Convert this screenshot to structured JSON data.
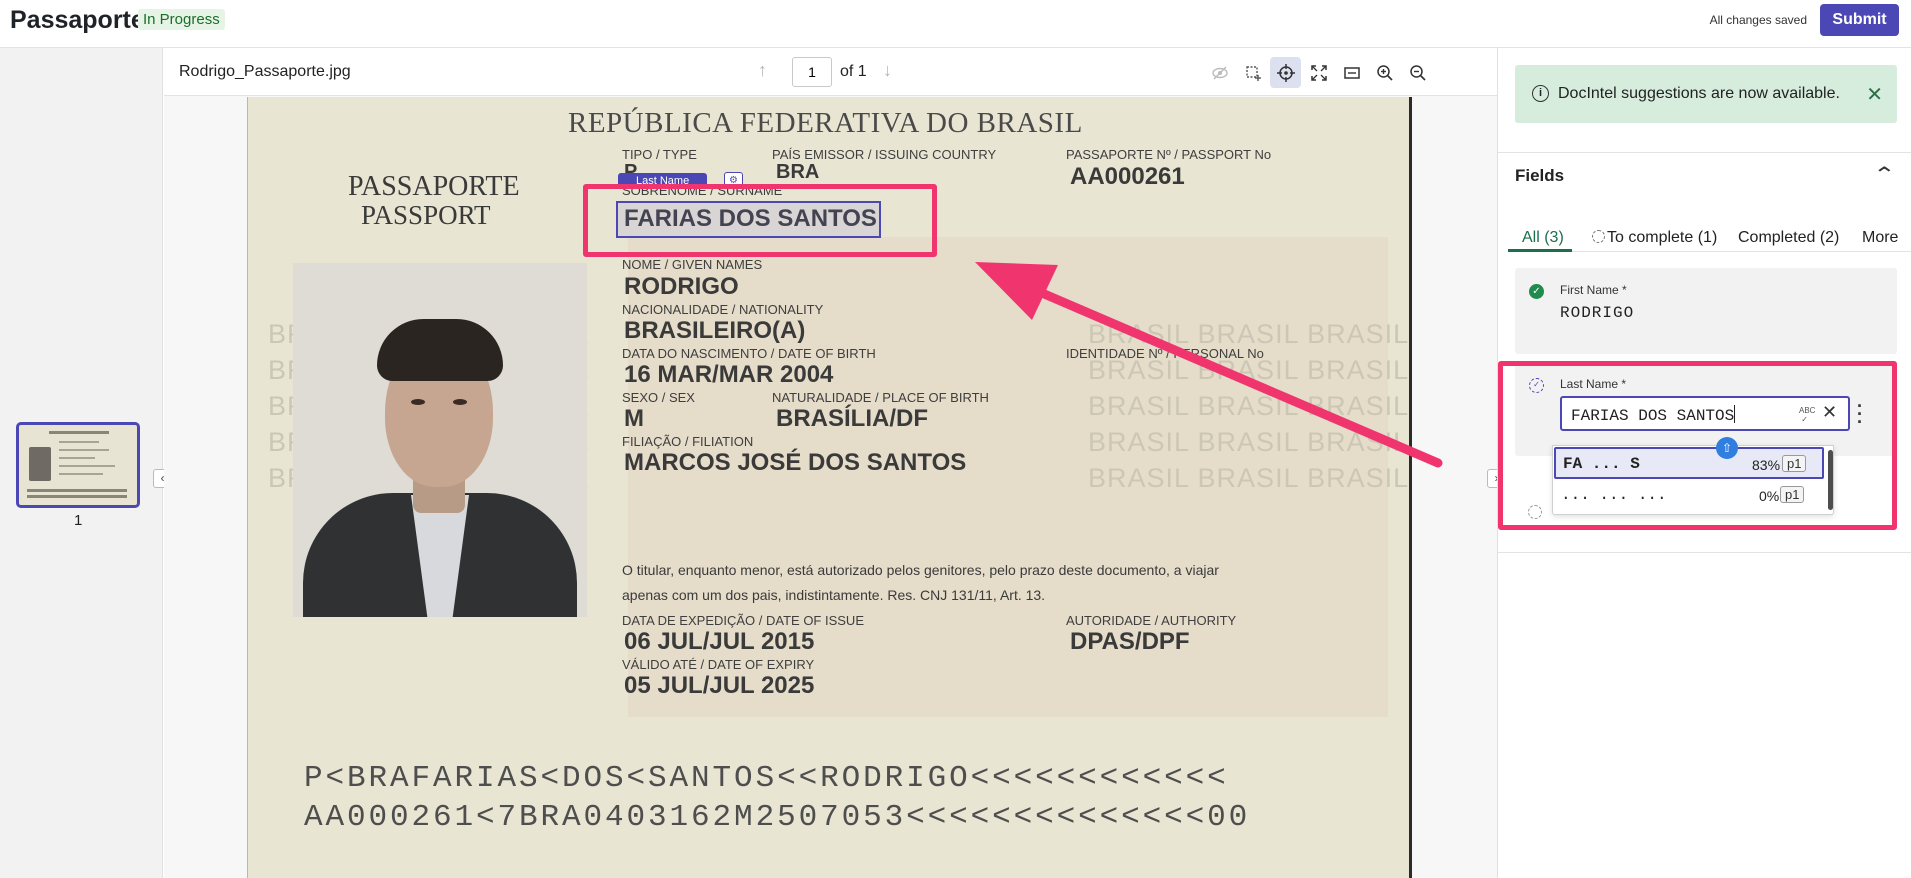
{
  "app": {
    "title": "Passaporte",
    "status": "In Progress",
    "save_status": "All changes saved",
    "submit_label": "Submit"
  },
  "thumbnails": [
    {
      "label": "1"
    }
  ],
  "viewer": {
    "file_name": "Rodrigo_Passaporte.jpg",
    "page": "1",
    "page_of": "of 1",
    "tools": [
      "eye-off-icon",
      "select-region-icon",
      "crosshair-icon",
      "fit-screen-icon",
      "fit-width-icon",
      "zoom-in-icon",
      "zoom-out-icon"
    ],
    "active_tool": "crosshair-icon"
  },
  "document": {
    "republic": "REPÚBLICA FEDERATIVA DO BRASIL",
    "passaporte": "PASSAPORTE",
    "passport": "PASSPORT",
    "tipo_label": "TIPO / TYPE",
    "tipo_value": "P",
    "pais_label": "PAÍS EMISSOR / ISSUING COUNTRY",
    "pais_value": "BRA",
    "passport_no_label": "PASSAPORTE Nº / PASSPORT No",
    "passport_no_value": "AA000261",
    "surname_label": "SOBRENOME / SURNAME",
    "surname_value": "FARIAS DOS SANTOS",
    "given_label": "NOME / GIVEN NAMES",
    "given_value": "RODRIGO",
    "nationality_label": "NACIONALIDADE / NATIONALITY",
    "nationality_value": "BRASILEIRO(A)",
    "dob_label": "DATA DO NASCIMENTO / DATE OF BIRTH",
    "dob_value": "16 MAR/MAR 2004",
    "id_label": "IDENTIDADE Nº / PERSONAL No",
    "sex_label": "SEXO / SEX",
    "sex_value": "M",
    "birthplace_label": "NATURALIDADE / PLACE OF BIRTH",
    "birthplace_value": "BRASÍLIA/DF",
    "filiation_label": "FILIAÇÃO / FILIATION",
    "filiation_value": "MARCOS JOSÉ DOS SANTOS",
    "notice_1": "O titular, enquanto menor, está autorizado pelos genitores, pelo prazo deste documento, a viajar",
    "notice_2": "apenas com um dos pais, indistintamente. Res. CNJ 131/11, Art. 13.",
    "issue_label": "DATA DE EXPEDIÇÃO / DATE OF ISSUE",
    "issue_value": "06 JUL/JUL 2015",
    "authority_label": "AUTORIDADE / AUTHORITY",
    "authority_value": "DPAS/DPF",
    "expiry_label": "VÁLIDO ATÉ / DATE OF EXPIRY",
    "expiry_value": "05 JUL/JUL 2025",
    "mrz_1": "P<BRAFARIAS<DOS<SANTOS<<RODRIGO<<<<<<<<<<<<",
    "mrz_2": "AA000261<7BRA0403162M2507053<<<<<<<<<<<<<<00",
    "watermark": "BRASIL BRASIL BRASIL",
    "field_tag": "Last Name"
  },
  "panel": {
    "toast": "DocIntel suggestions are now available.",
    "fields_title": "Fields",
    "tabs": [
      {
        "label": "All (3)"
      },
      {
        "label": "To complete (1)"
      },
      {
        "label": "Completed (2)"
      },
      {
        "label": "More"
      }
    ],
    "first_name": {
      "label": "First Name *",
      "value": "RODRIGO"
    },
    "last_name": {
      "label": "Last Name *",
      "value": "FARIAS DOS SANTOS",
      "suggestions": [
        {
          "text": "FA ... S",
          "confidence": "83%",
          "page": "p1"
        },
        {
          "text": "...  ...  ...",
          "confidence": "0%",
          "page": "p1"
        }
      ]
    }
  },
  "colors": {
    "accent": "#4b47b5",
    "highlight": "#f0346e",
    "success": "#1e8c4e",
    "toast_bg": "#d6ecdd"
  }
}
